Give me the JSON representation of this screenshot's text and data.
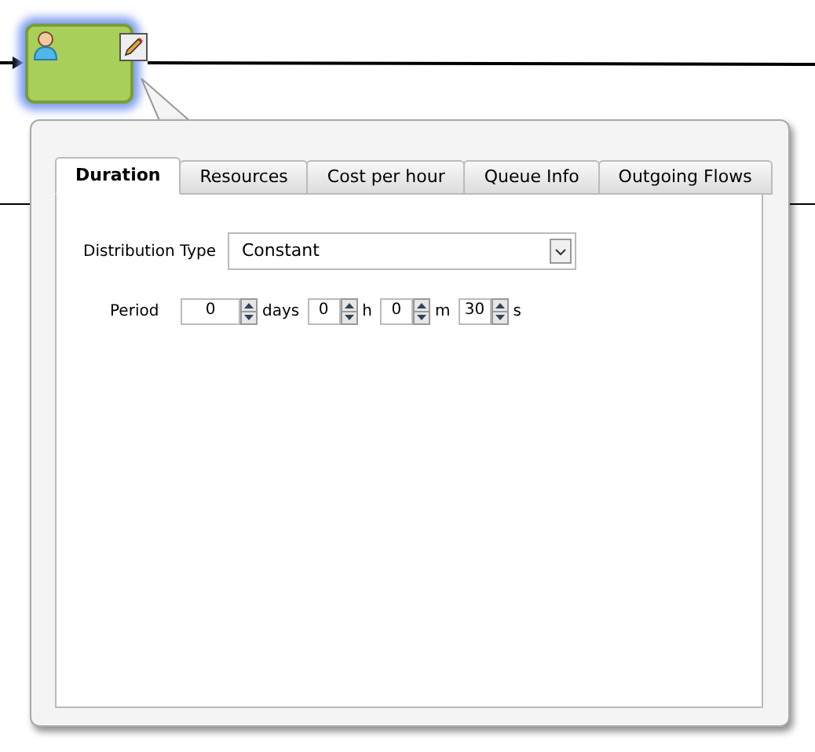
{
  "tabs": [
    {
      "label": "Duration",
      "selected": true
    },
    {
      "label": "Resources",
      "selected": false
    },
    {
      "label": "Cost per hour",
      "selected": false
    },
    {
      "label": "Queue Info",
      "selected": false
    },
    {
      "label": "Outgoing Flows",
      "selected": false
    }
  ],
  "distribution_type": {
    "label": "Distribution Type",
    "value": "Constant"
  },
  "period": {
    "label": "Period",
    "fields": [
      {
        "value": "0",
        "unit": "days"
      },
      {
        "value": "0",
        "unit": "h"
      },
      {
        "value": "0",
        "unit": "m"
      },
      {
        "value": "30",
        "unit": "s"
      }
    ]
  }
}
